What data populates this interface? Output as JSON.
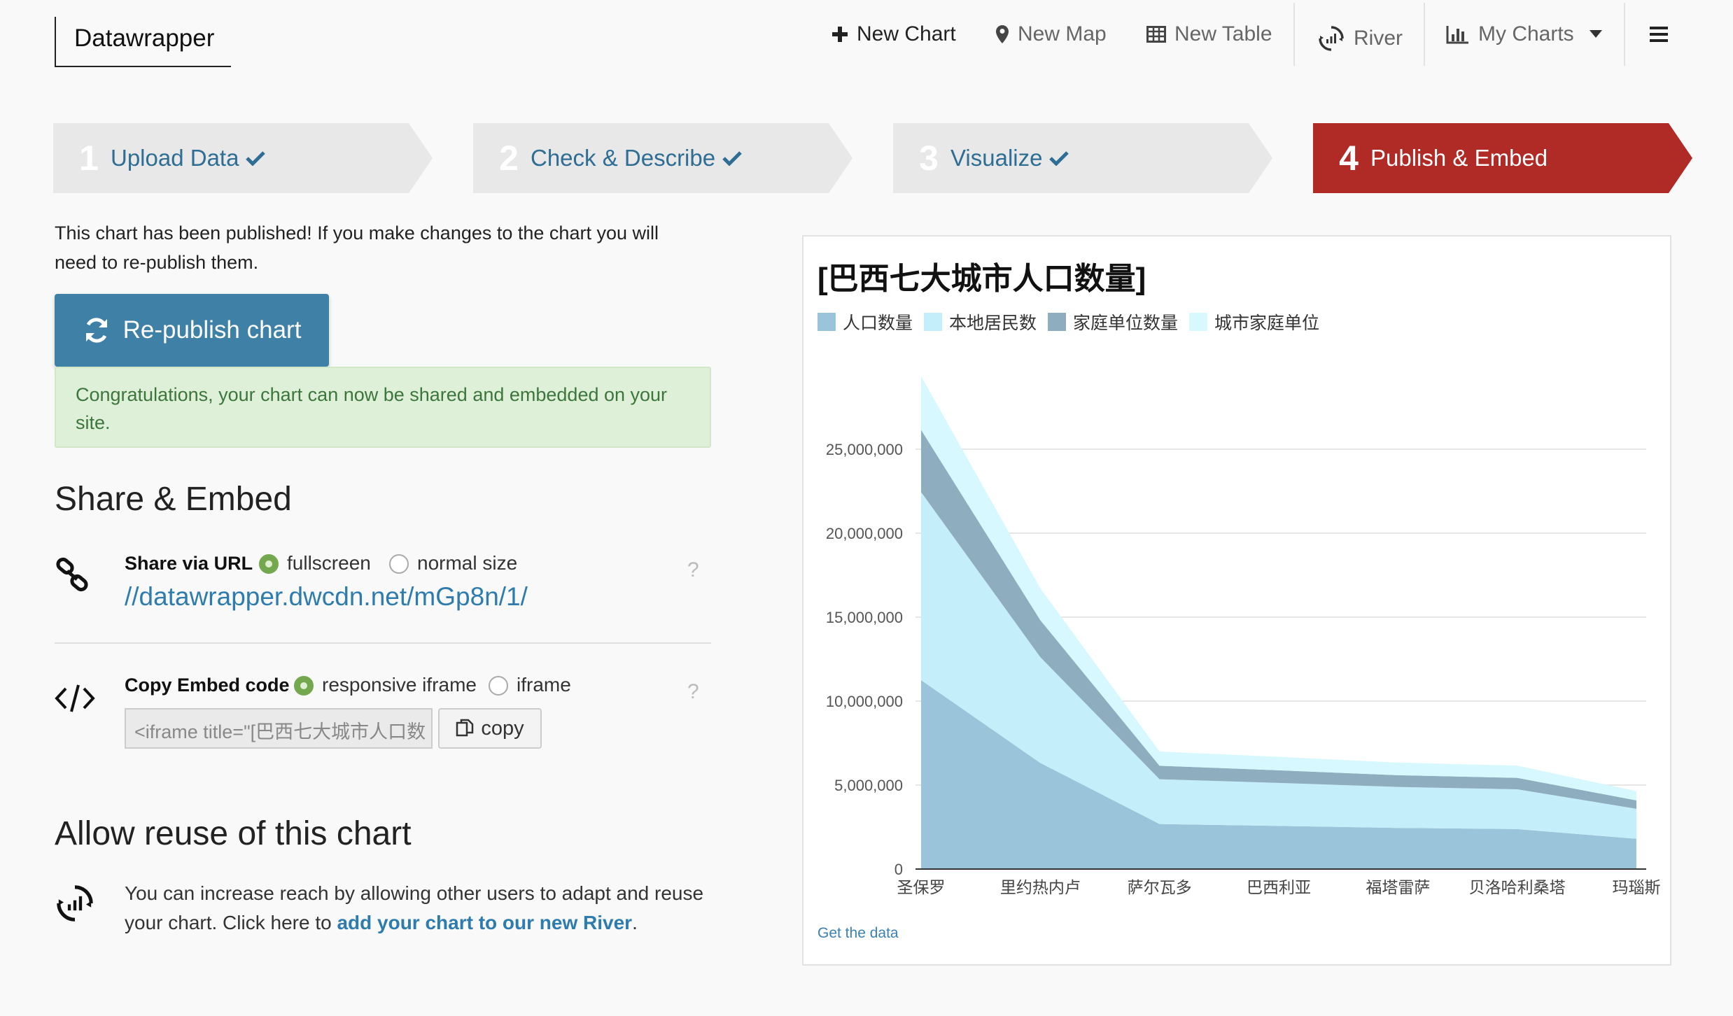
{
  "brand": "Datawrapper",
  "nav": {
    "new_chart": "New Chart",
    "new_map": "New Map",
    "new_table": "New Table",
    "river": "River",
    "my_charts": "My Charts"
  },
  "steps": [
    {
      "num": "1",
      "label": "Upload Data",
      "done": true
    },
    {
      "num": "2",
      "label": "Check & Describe",
      "done": true
    },
    {
      "num": "3",
      "label": "Visualize",
      "done": true
    },
    {
      "num": "4",
      "label": "Publish & Embed",
      "active": true
    }
  ],
  "publish": {
    "note": "This chart has been published! If you make changes to the chart you will need to re-publish them.",
    "republish_label": "Re-publish chart",
    "success": "Congratulations, your chart can now be shared and embedded on your site."
  },
  "share": {
    "heading": "Share & Embed",
    "url_label": "Share via URL",
    "opt_fullscreen": "fullscreen",
    "opt_normal": "normal size",
    "url": "//datawrapper.dwcdn.net/mGp8n/1/",
    "embed_label": "Copy Embed code",
    "opt_responsive": "responsive iframe",
    "opt_iframe": "iframe",
    "embed_value": "<iframe title=\"[巴西七大城市人口数",
    "copy_label": "copy",
    "help": "?"
  },
  "reuse": {
    "heading": "Allow reuse of this chart",
    "text": "You can increase reach by allowing other users to adapt and reuse your chart. Click here to ",
    "link": "add your chart to our new River",
    "end": "."
  },
  "chart": {
    "get_data": "Get the data"
  },
  "chart_data": {
    "type": "area",
    "title": "[巴西七大城市人口数量]",
    "stacked": true,
    "categories": [
      "圣保罗",
      "里约热内卢",
      "萨尔瓦多",
      "巴西利亚",
      "福塔雷萨",
      "贝洛哈利桑塔",
      "玛瑙斯"
    ],
    "series": [
      {
        "name": "人口数量",
        "color": "#9ac4d9",
        "values": [
          11250000,
          6320000,
          2680000,
          2570000,
          2450000,
          2380000,
          1800000
        ]
      },
      {
        "name": "本地居民数",
        "color": "#c5eefb",
        "values": [
          11200000,
          6300000,
          2670000,
          2560000,
          2440000,
          2370000,
          1790000
        ]
      },
      {
        "name": "家庭单位数量",
        "color": "#8eadbe",
        "values": [
          3700000,
          2200000,
          800000,
          750000,
          700000,
          680000,
          500000
        ]
      },
      {
        "name": "城市家庭单位",
        "color": "#d6f8fe",
        "values": [
          3200000,
          1900000,
          850000,
          800000,
          750000,
          730000,
          550000
        ]
      }
    ],
    "yticks": [
      0,
      5000000,
      10000000,
      15000000,
      20000000,
      25000000
    ],
    "ytick_labels": [
      "0",
      "5,000,000",
      "10,000,000",
      "15,000,000",
      "20,000,000",
      "25,000,000"
    ],
    "ylim": [
      0,
      29350000
    ],
    "grid": true,
    "legend": "top-left"
  }
}
